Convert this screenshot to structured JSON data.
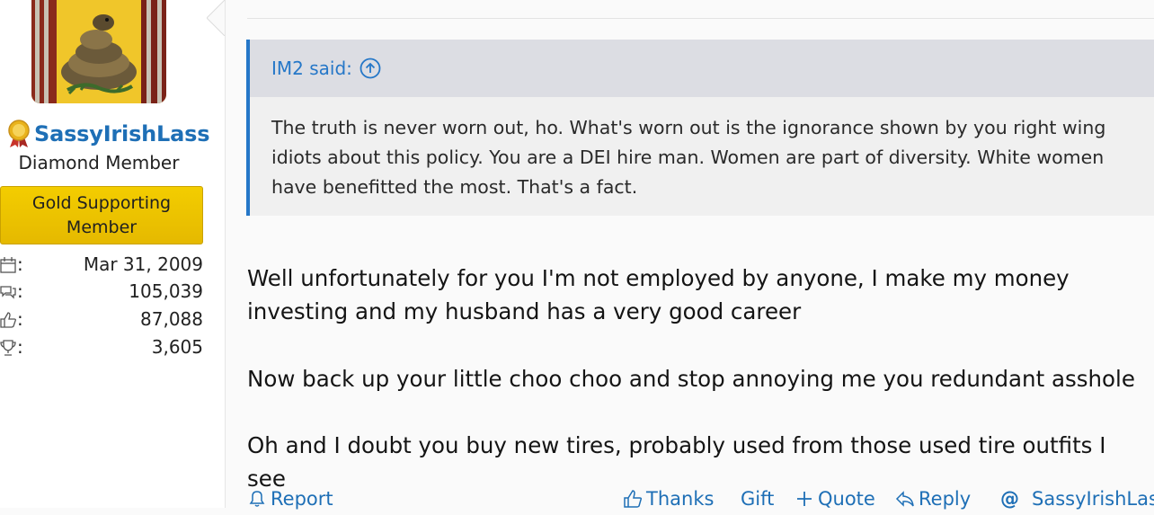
{
  "user": {
    "name": "SassyIrishLass",
    "title": "Diamond Member",
    "banner": "Gold Supporting Member",
    "stats": [
      {
        "icon": "calendar-icon",
        "value": "Mar 31, 2009"
      },
      {
        "icon": "messages-icon",
        "value": "105,039"
      },
      {
        "icon": "thumbs-up-icon",
        "value": "87,088"
      },
      {
        "icon": "trophy-icon",
        "value": "3,605"
      }
    ],
    "colon": ":"
  },
  "quote": {
    "author": "IM2 said:",
    "text": "The truth is never worn out, ho. What's worn out is the ignorance shown by you right wing idiots about this policy. You are a DEI hire man. Women are part of diversity. White women have benefitted the most. That's a fact."
  },
  "post": {
    "paragraphs": [
      "Well unfortunately for you I'm not employed by anyone, I make my money investing and my husband has a very good career",
      "Now back up your little choo choo and stop annoying me you redundant asshole",
      "Oh and I doubt you buy new tires, probably used from those used tire outfits I see"
    ]
  },
  "actions": {
    "report": "Report",
    "thanks": "Thanks",
    "gift": "Gift",
    "quote": "Quote",
    "reply": "Reply",
    "mention": "SassyIrishLass"
  },
  "colors": {
    "link": "#1e6fb6",
    "quote_border": "#2577c8",
    "banner_gold": "#f3cd00"
  }
}
